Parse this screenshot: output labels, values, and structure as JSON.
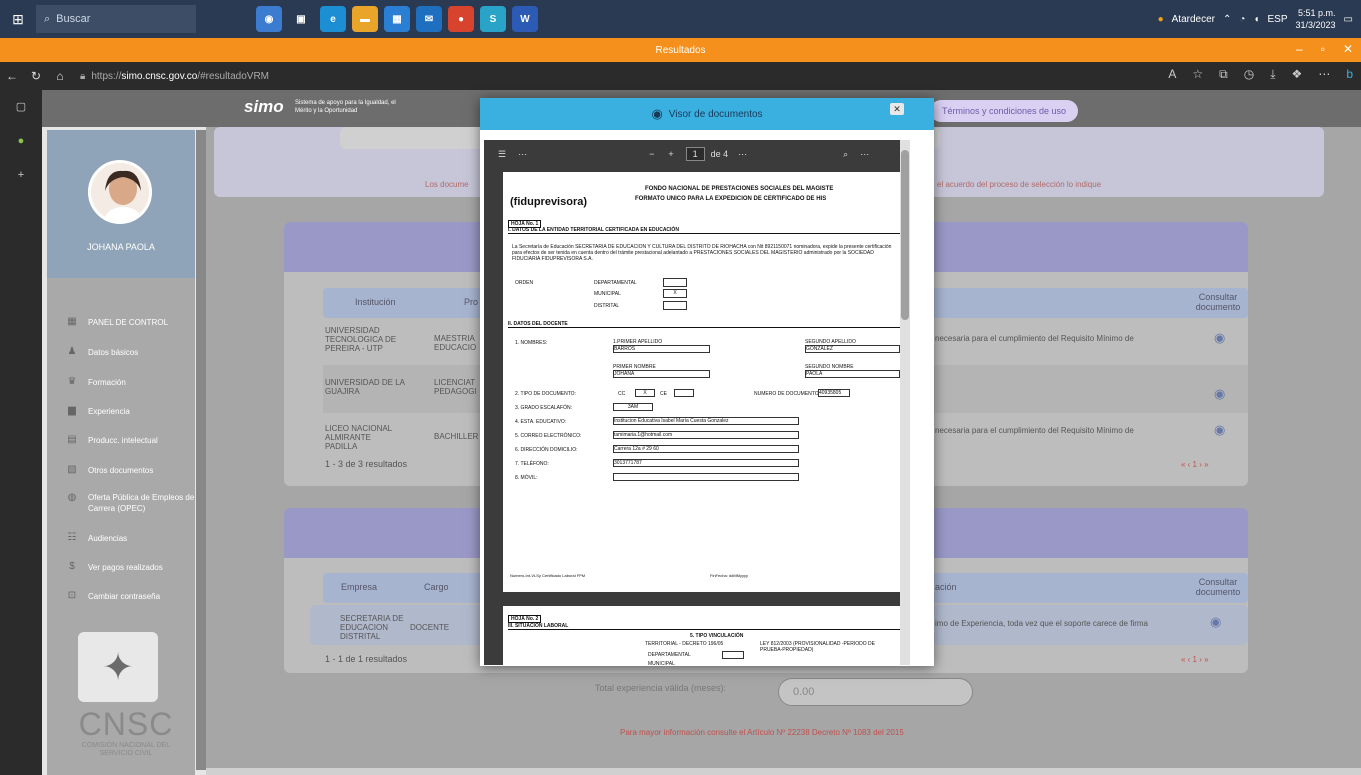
{
  "taskbar": {
    "search_placeholder": "Buscar",
    "weather": "Atardecer",
    "lang": "ESP",
    "time": "5:51 p.m.",
    "date": "31/3/2023"
  },
  "window": {
    "title": "Resultados"
  },
  "browser": {
    "url_prefix": "https://",
    "url_domain": "simo.cnsc.gov.co",
    "url_path": "/#resultadoVRM"
  },
  "header": {
    "logo": "simo",
    "tagline": "Sistema de apoyo para la Igualdad, el Mérito y la Oportunidad",
    "terms_button": "Términos y condiciones de uso"
  },
  "sidebar": {
    "user_name": "JOHANA PAOLA",
    "items": [
      {
        "label": "PANEL DE CONTROL",
        "icon": "dashboard-icon"
      },
      {
        "label": "Datos básicos",
        "icon": "user-data-icon"
      },
      {
        "label": "Formación",
        "icon": "graduation-icon"
      },
      {
        "label": "Experiencia",
        "icon": "briefcase-icon"
      },
      {
        "label": "Producc. intelectual",
        "icon": "document-icon"
      },
      {
        "label": "Otros documentos",
        "icon": "folder-icon"
      },
      {
        "label": "Oferta Pública de Empleos de Carrera (OPEC)",
        "icon": "globe-icon"
      },
      {
        "label": "Audiencias",
        "icon": "audience-icon"
      },
      {
        "label": "Ver pagos realizados",
        "icon": "dollar-icon"
      },
      {
        "label": "Cambiar contraseña",
        "icon": "lock-icon"
      }
    ],
    "org_name": "CNSC",
    "org_full": "COMISIÓN NACIONAL DEL SERVICIO CIVIL"
  },
  "main": {
    "notice_left": "Los docume",
    "notice_right": "el acuerdo del proceso de selección lo indique",
    "education_table": {
      "headers": [
        "Institución",
        "Pro",
        "Consultar documento"
      ],
      "rows": [
        {
          "institution": "UNIVERSIDAD TECNOLOGICA DE PEREIRA - UTP",
          "program": "MAESTRIA EDUCACIO",
          "note": "necesaria para el cumplimiento del Requisito Mínimo de"
        },
        {
          "institution": "UNIVERSIDAD DE LA GUAJIRA",
          "program": "LICENCIAT PEDAGOGI",
          "note": ""
        },
        {
          "institution": "LICEO NACIONAL ALMIRANTE PADILLA",
          "program": "BACHILLER",
          "note": "necesaria para el cumplimiento del Requisito Mínimo de"
        }
      ],
      "count": "1 - 3 de 3 resultados",
      "pager": "« ‹ 1 › »"
    },
    "experience_table": {
      "headers": [
        "Empresa",
        "Cargo",
        "ación",
        "Consultar documento"
      ],
      "rows": [
        {
          "company": "SECRETARIA DE EDUCACION DISTRITAL",
          "position": "DOCENTE",
          "note": "imo de Experiencia, toda vez que el soporte carece de firma"
        }
      ],
      "count": "1 - 1 de 1 resultados",
      "pager": "« ‹ 1 › »"
    },
    "total_label": "Total experiencia válida (meses):",
    "total_value": "0.00",
    "footnote": "Para mayor información consulte el Artículo Nº 22238 Decreto Nº 1083 del 2015"
  },
  "modal": {
    "title": "Visor de documentos",
    "close": "✕",
    "toolbar": {
      "page": "1",
      "of": "de 4"
    },
    "doc": {
      "brand": "(fiduprevisora)",
      "title1": "FONDO NACIONAL DE PRESTACIONES SOCIALES DEL MAGISTE",
      "title2": "FORMATO UNICO PARA LA EXPEDICION DE CERTIFICADO DE HIS",
      "sheet1": "HOJA No. 1",
      "sec1": "I. DATOS DE LA ENTIDAD TERRITORIAL CERTIFICADA EN EDUCACIÓN",
      "para": "La Secretaría de Educación SECRETARIA DE EDUCACION Y CULTURA DEL DISTRITO DE RIOHACHA con Nit 8921150071 nominadora, expide la presente certificación para efectos de ser tenida en cuenta dentro del trámite prestacional adelantado a PRESTACIONES SOCIALES DEL MAGISTERIO administrado por la SOCIEDAD FIDUCIARIA FIDUPREVISORA S.A.",
      "orden": "ORDEN",
      "dept": "DEPARTAMENTAL",
      "mun": "MUNICIPAL",
      "mun_val": "X",
      "dist": "DISTRITAL",
      "sec2": "II. DATOS DEL DOCENTE",
      "nombres": "1. NOMBRES:",
      "primer_ap_l": "1.PRIMER APELLIDO",
      "primer_ap": "BARROS",
      "segundo_ap_l": "SEGUNDO APELLIDO",
      "segundo_ap": "GONZALEZ",
      "primer_no_l": "PRIMER NOMBRE",
      "primer_no": "JOHANA",
      "segundo_no_l": "SEGUNDO NOMBRE",
      "segundo_no": "PAOLA",
      "tipo_doc": "2. TIPO DE DOCUMENTO:",
      "cc": "CC",
      "cc_val": "X",
      "ce": "CE",
      "num_doc_l": "NUMERO DE DOCUMENTO",
      "num_doc": "40935805",
      "grado_l": "3. GRADO ESCALAFÓN:",
      "grado": "3AM",
      "estab_l": "4. ESTA. EDUCATIVO:",
      "estab": "Institucion Educativa Isabel María Cuesta Gonzalez",
      "correo_l": "5. CORREO ELECTRÓNICO:",
      "correo": "tamimaria.1@hotmail.com",
      "dir_l": "6. DIRECCIÓN DOMICILIO:",
      "dir": "Carrera 12a # 29 60",
      "tel_l": "7. TELÉFONO:",
      "tel": "3013771787",
      "movil_l": "8. MÓVIL:",
      "footer_l": "Numero-Int-VLSy Certificado Laboral FPM",
      "footer_r": "FinFecha: ddMMyyyy",
      "sheet2": "HOJA No. 2",
      "sec3": "III. SITUACIÓN LABORAL",
      "tipo_vinc": "5. TIPO VINCULACIÓN",
      "territorial": "TERRITORIAL - DECRETO 196/05",
      "ley": "LEY 812/2003 (PROVISIONALIDAD -PERIODO DE PRUEBA-PROPIEDAD)",
      "dept2": "DEPARTAMENTAL",
      "mun2": "MUNICIPAL"
    }
  },
  "colors": {
    "accent": "#3ab0e0",
    "taskbar": "#2a3a52",
    "titlebar": "#f4901b",
    "band": "#9a98c7"
  }
}
